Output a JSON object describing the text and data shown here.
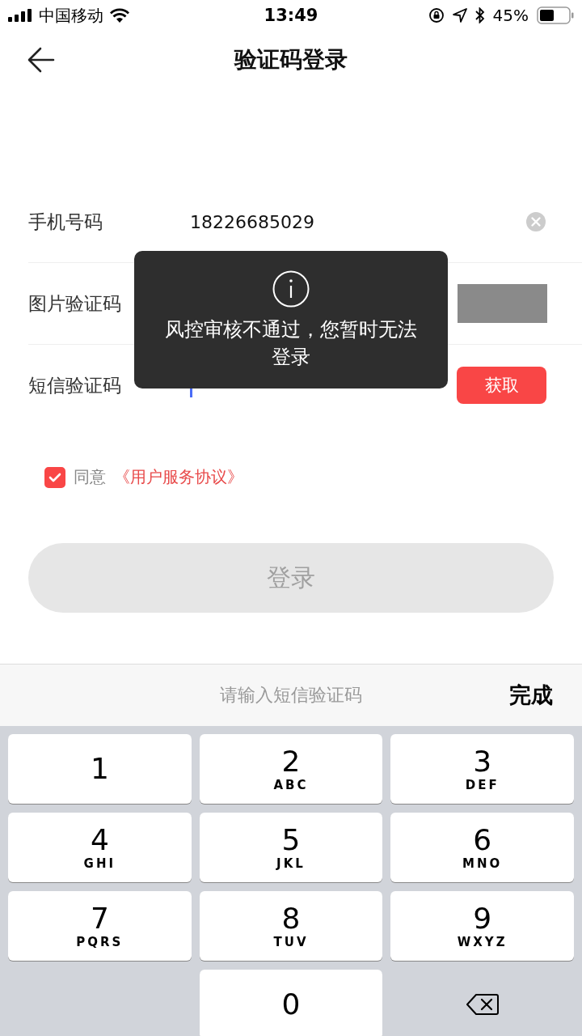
{
  "status_bar": {
    "carrier": "中国移动",
    "time": "13:49",
    "battery": "45%"
  },
  "nav": {
    "title": "验证码登录"
  },
  "form": {
    "rows": [
      {
        "kind": "phone",
        "label": "手机号码",
        "value": "18226685029"
      },
      {
        "kind": "captcha",
        "label": "图片验证码"
      },
      {
        "kind": "sms",
        "label": "短信验证码",
        "button": "获取"
      }
    ]
  },
  "agreement": {
    "checked": true,
    "label": "同意",
    "link": "《用户服务协议》"
  },
  "login_button": {
    "label": "登录",
    "disabled": true
  },
  "toast": {
    "message": "风控审核不通过，您暂时无法登录"
  },
  "keyboard": {
    "hint": "请输入短信验证码",
    "done": "完成",
    "keys": [
      {
        "kind": "digit",
        "digit": "1"
      },
      {
        "kind": "digit",
        "digit": "2",
        "letters": "ABC"
      },
      {
        "kind": "digit",
        "digit": "3",
        "letters": "DEF"
      },
      {
        "kind": "digit",
        "digit": "4",
        "letters": "GHI"
      },
      {
        "kind": "digit",
        "digit": "5",
        "letters": "JKL"
      },
      {
        "kind": "digit",
        "digit": "6",
        "letters": "MNO"
      },
      {
        "kind": "digit",
        "digit": "7",
        "letters": "PQRS"
      },
      {
        "kind": "digit",
        "digit": "8",
        "letters": "TUV"
      },
      {
        "kind": "digit",
        "digit": "9",
        "letters": "WXYZ"
      },
      {
        "kind": "blank"
      },
      {
        "kind": "digit",
        "digit": "0"
      },
      {
        "kind": "delete"
      }
    ]
  }
}
